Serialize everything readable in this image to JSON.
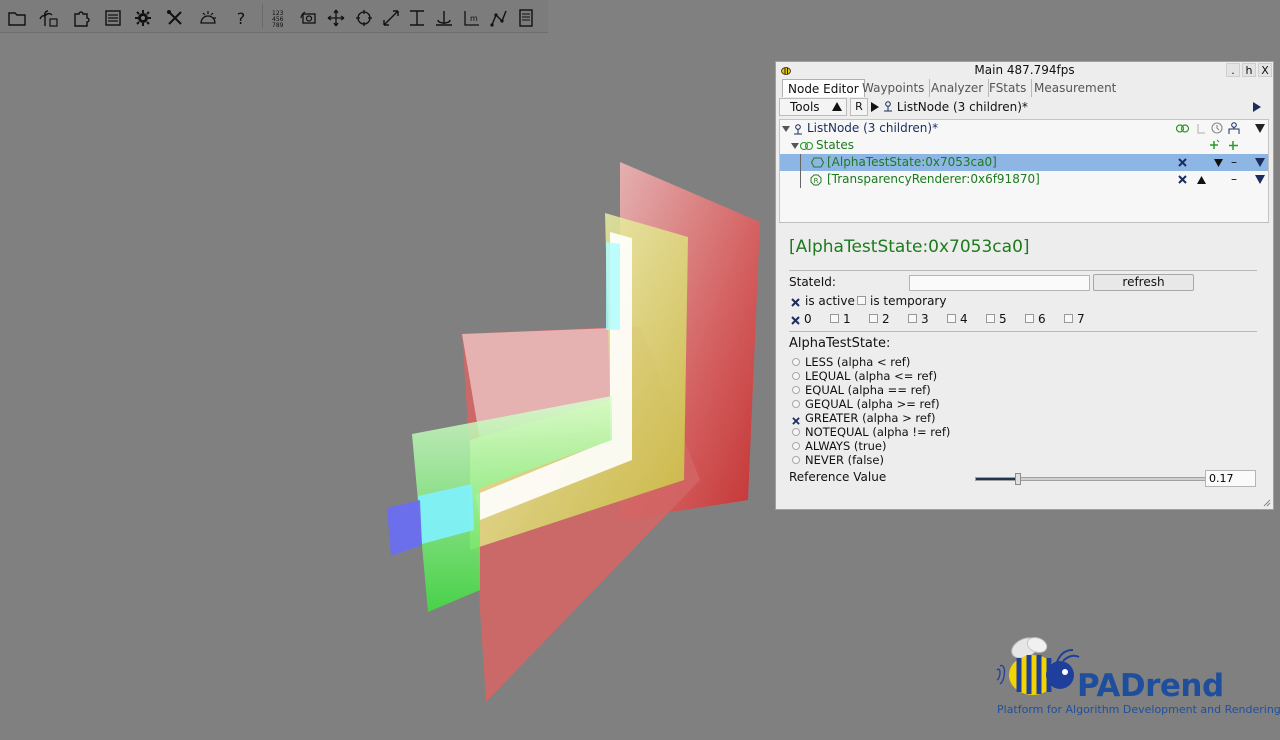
{
  "toolbar": {
    "icons": [
      "folder-icon",
      "palm-tree-icon",
      "puzzle-icon",
      "list-icon",
      "gear-icon",
      "tools-icon",
      "lighting-icon",
      "help-icon",
      "numbers-grid-icon",
      "camera-rotate-icon",
      "move-icon",
      "rotate-icon",
      "scale-icon",
      "align-icon",
      "anchor-icon",
      "measure-icon",
      "path-icon",
      "notes-icon"
    ]
  },
  "window": {
    "title": "Main 487.794fps",
    "controls": [
      ".",
      "h",
      "X"
    ],
    "tabs": [
      "Node Editor",
      "Waypoints",
      "Analyzer",
      "FStats",
      "Measurement"
    ],
    "tools_label": "Tools",
    "r_label": "R",
    "path_label": "ListNode (3 children)*",
    "tree": {
      "root": "ListNode (3 children)*",
      "states": "States",
      "state1": "[AlphaTestState:0x7053ca0]",
      "state2": "[TransparencyRenderer:0x6f91870]"
    },
    "detail": {
      "title": "[AlphaTestState:0x7053ca0]",
      "stateid_label": "StateId:",
      "stateid_value": "",
      "refresh_label": "refresh",
      "is_active_label": "is active",
      "is_active": true,
      "is_temporary_label": "is temporary",
      "is_temporary": false,
      "channels": [
        {
          "label": "0",
          "checked": true
        },
        {
          "label": "1",
          "checked": false
        },
        {
          "label": "2",
          "checked": false
        },
        {
          "label": "3",
          "checked": false
        },
        {
          "label": "4",
          "checked": false
        },
        {
          "label": "5",
          "checked": false
        },
        {
          "label": "6",
          "checked": false
        },
        {
          "label": "7",
          "checked": false
        }
      ],
      "section_label": "AlphaTestState:",
      "modes": [
        {
          "label": "LESS (alpha < ref)",
          "checked": false
        },
        {
          "label": "LEQUAL (alpha <= ref)",
          "checked": false
        },
        {
          "label": "EQUAL (alpha == ref)",
          "checked": false
        },
        {
          "label": "GEQUAL (alpha >= ref)",
          "checked": false
        },
        {
          "label": "GREATER (alpha > ref)",
          "checked": true
        },
        {
          "label": "NOTEQUAL (alpha != ref)",
          "checked": false
        },
        {
          "label": "ALWAYS (true)",
          "checked": false
        },
        {
          "label": "NEVER (false)",
          "checked": false
        }
      ],
      "reference_label": "Reference Value",
      "reference_value": "0.17",
      "reference_fraction": 0.17
    }
  },
  "logo": {
    "name": "PADrend",
    "subtitle": "Platform for Algorithm Development and Rendering"
  },
  "colors": {
    "background": "#808080",
    "accent_green": "#1d7a1d",
    "selection": "#8eb6e4",
    "logo_blue": "#1f4f9c",
    "logo_yellow": "#f2d400"
  }
}
